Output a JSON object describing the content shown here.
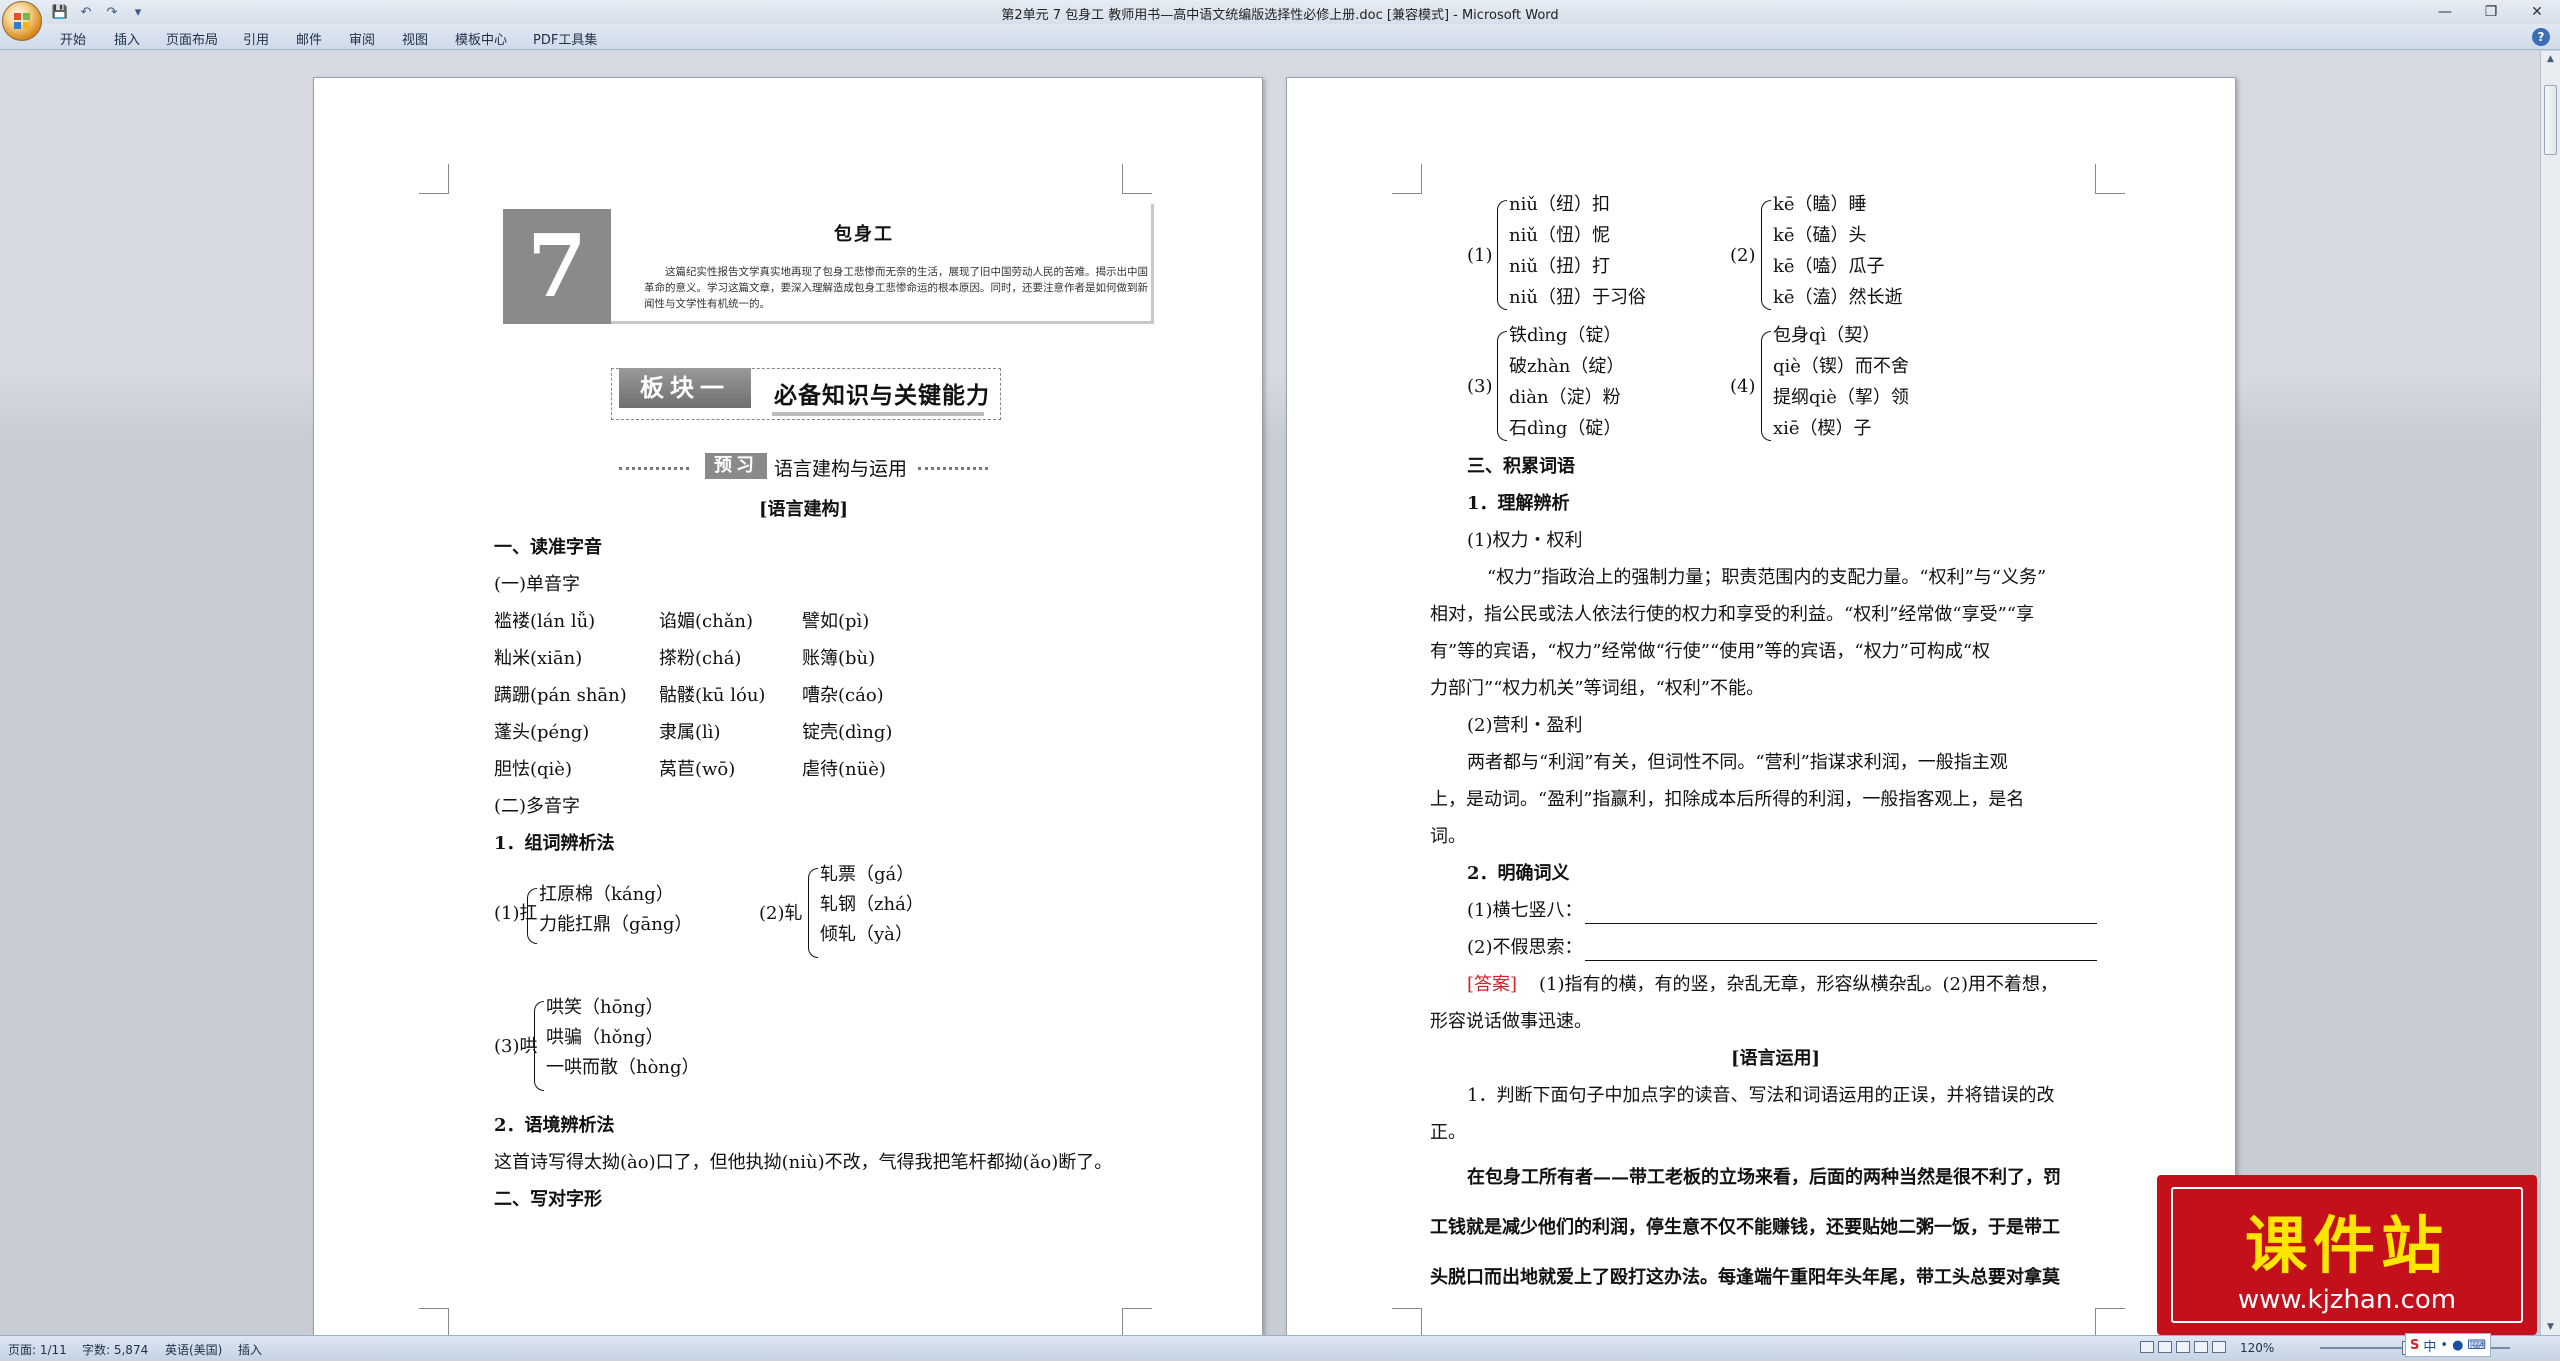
{
  "window": {
    "title": "第2单元 7 包身工 教师用书—高中语文统编版选择性必修上册.doc [兼容模式] - Microsoft Word"
  },
  "ribbon": {
    "tabs": [
      "开始",
      "插入",
      "页面布局",
      "引用",
      "邮件",
      "审阅",
      "视图",
      "模板中心",
      "PDF工具集"
    ]
  },
  "page1": {
    "lesson_number": "7",
    "lesson_title": "包身工",
    "lesson_intro": "这篇纪实性报告文学真实地再现了包身工悲惨而无奈的生活，展现了旧中国劳动人民的苦难。揭示出中国革命的意义。学习这篇文章，要深入理解造成包身工悲惨命运的根本原因。同时，还要注意作者是如何做到新闻性与文学性有机统一的。",
    "block_label": "板块一",
    "block_title": "必备知识与关键能力",
    "preview_tag": "预习",
    "preview_title": "语言建构与运用",
    "section_label": "[语言建构]",
    "h1": "一、读准字音",
    "h1_sub1": "(一)单音字",
    "single_chars": [
      [
        "褴褛(lán lǚ)",
        "谄媚(chǎn)",
        "譬如(pì)"
      ],
      [
        "籼米(xiān)",
        "搽粉(chá)",
        "账簿(bù)"
      ],
      [
        "蹒跚(pán shān)",
        "骷髅(kū lóu)",
        "嘈杂(cáo)"
      ],
      [
        "蓬头(péng)",
        "隶属(lì)",
        "锭壳(dìng)"
      ],
      [
        "胆怯(qiè)",
        "莴苣(wō)",
        "虐待(nüè)"
      ]
    ],
    "h1_sub2": "(二)多音字",
    "method1": "1．组词辨析法",
    "poly1_label": "(1)扛",
    "poly1": [
      "扛原棉（káng）",
      "力能扛鼎（gāng）"
    ],
    "poly2_label": "(2)轧",
    "poly2": [
      "轧票（gá）",
      "轧钢（zhá）",
      "倾轧（yà）"
    ],
    "poly3_label": "(3)哄",
    "poly3": [
      "哄笑（hōng）",
      "哄骗（hǒng）",
      "一哄而散（hòng）"
    ],
    "method2": "2．语境辨析法",
    "context_sentence": "这首诗写得太拗(ào)口了，但他执拗(niù)不改，气得我把笔杆都拗(ǎo)断了。",
    "h2": "二、写对字形"
  },
  "page2": {
    "g1_label": "(1)",
    "g1": [
      "niǔ（纽）扣",
      "niǔ（忸）怩",
      "niǔ（扭）打",
      "niǔ（狃）于习俗"
    ],
    "g2_label": "(2)",
    "g2": [
      "kē（瞌）睡",
      "kē（磕）头",
      "kē（嗑）瓜子",
      "kē（溘）然长逝"
    ],
    "g3_label": "(3)",
    "g3": [
      "铁dìng（锭）",
      "破zhàn（绽）",
      "diàn（淀）粉",
      "石dìng（碇）"
    ],
    "g4_label": "(4)",
    "g4": [
      "包身qì（契）",
      "qiè（锲）而不舍",
      "提纲qiè（挈）领",
      "xiē（楔）子"
    ],
    "h3": "三、积累词语",
    "s1": "1．理解辨析",
    "p1_title": "(1)权力・权利",
    "p1_lines": [
      "“权力”指政治上的强制力量；职责范围内的支配力量。“权利”与“义务”",
      "相对，指公民或法人依法行使的权力和享受的利益。“权利”经常做“享受”“享",
      "有”等的宾语，“权力”经常做“行使”“使用”等的宾语，“权力”可构成“权",
      "力部门”“权力机关”等词组，“权利”不能。"
    ],
    "p2_title": "(2)营利・盈利",
    "p2_lines": [
      "两者都与“利润”有关，但词性不同。“营利”指谋求利润，一般指主观",
      "上，是动词。“盈利”指赢利，扣除成本后所得的利润，一般指客观上，是名",
      "词。"
    ],
    "s2": "2．明确词义",
    "q1": "(1)横七竖八：",
    "q2": "(2)不假思索：",
    "answer_tag": "[答案]",
    "answer_line1": "(1)指有的横，有的竖，杂乱无章，形容纵横杂乱。(2)用不着想，",
    "answer_line2": "形容说话做事迅速。",
    "section2_label": "[语言运用]",
    "u1_line1": "1．判断下面句子中加点字的读音、写法和词语运用的正误，并将错误的改",
    "u1_line2": "正。",
    "bold_lines": [
      "在包身工所有者——带工老板的立场来看，后面的两种当然是很不利了，罚",
      "工钱就是减少他们的利润，停生意不仅不能赚钱，还要贴她二粥一饭，于是带工",
      "头脱口而出地就爱上了殴打这办法。每逢端午重阳年头年尾，带工头总要对拿莫"
    ]
  },
  "statusbar": {
    "page": "页面: 1/11",
    "words": "字数: 5,874",
    "lang": "英语(美国)",
    "mode": "插入",
    "zoom": "120%"
  },
  "watermark": {
    "title": "课件站",
    "url": "www.kjzhan.com"
  },
  "ime": {
    "s": "S",
    "lang": "中"
  }
}
